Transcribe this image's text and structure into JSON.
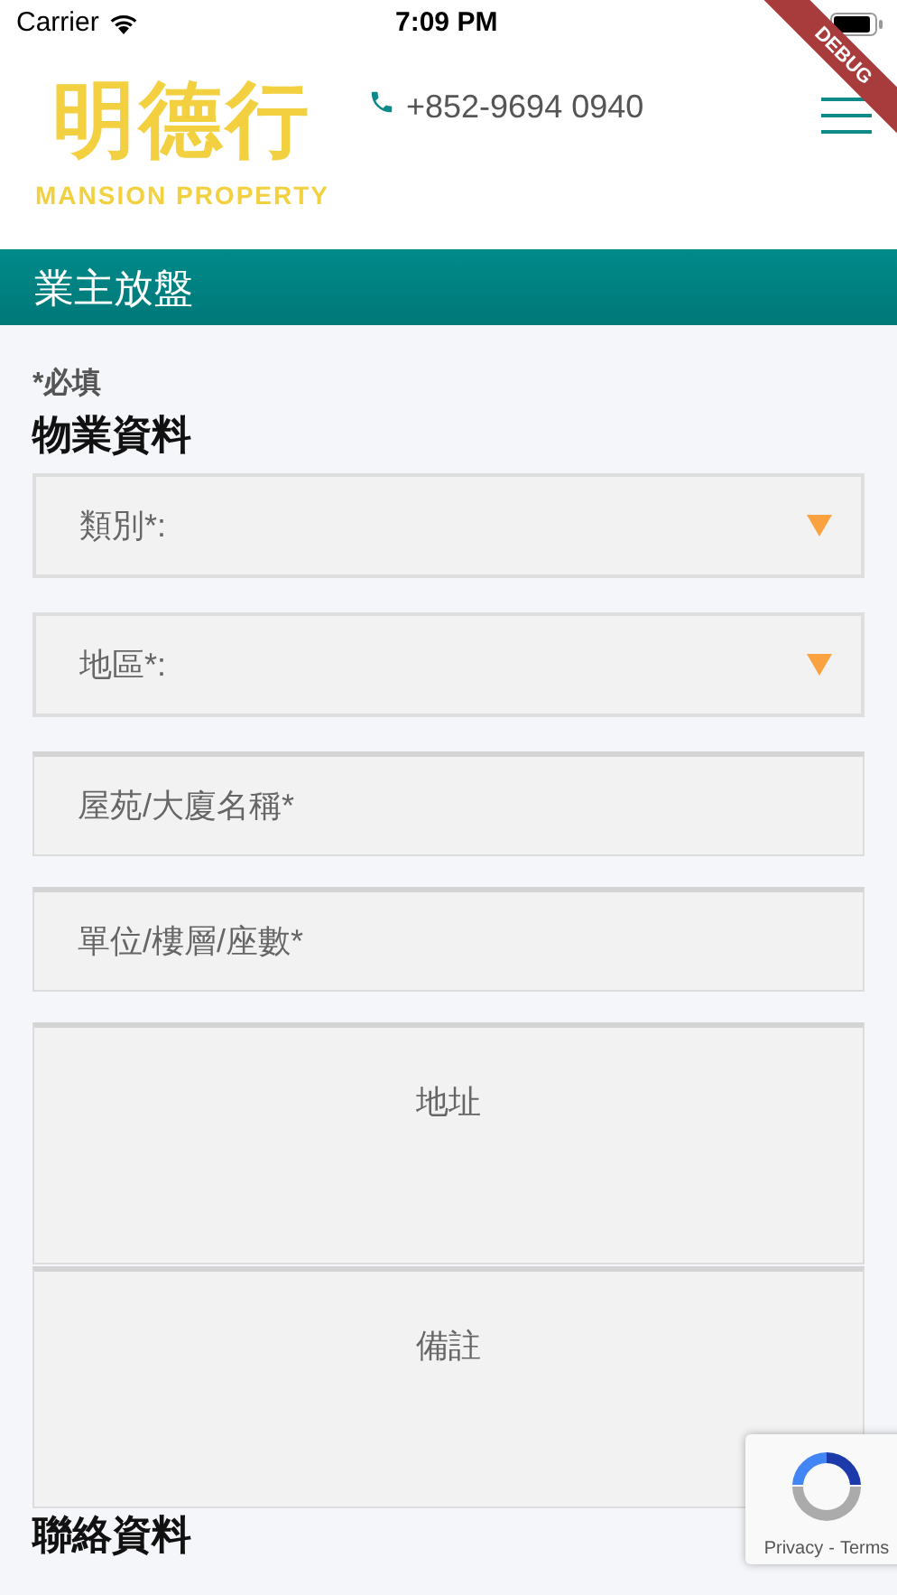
{
  "status_bar": {
    "carrier": "Carrier",
    "time": "7:09 PM"
  },
  "debug_banner": "DEBUG",
  "header": {
    "logo_name": "明德行",
    "logo_subtitle": "MANSION PROPERTY",
    "phone": "+852-9694 0940"
  },
  "page_title": "業主放盤",
  "required_note": "*必填",
  "section_title": "物業資料",
  "fields": [
    {
      "kind": "select",
      "placeholder": "類別*:"
    },
    {
      "kind": "select",
      "placeholder": "地區*:"
    },
    {
      "kind": "input",
      "placeholder": "屋苑/大廈名稱*"
    },
    {
      "kind": "input",
      "placeholder": "單位/樓層/座數*"
    },
    {
      "kind": "textarea",
      "placeholder": "地址"
    },
    {
      "kind": "textarea",
      "placeholder": "備註"
    }
  ],
  "next_section_title": "聯絡資料",
  "recaptcha": {
    "privacy": "Privacy",
    "separator": "-",
    "terms": "Terms"
  }
}
